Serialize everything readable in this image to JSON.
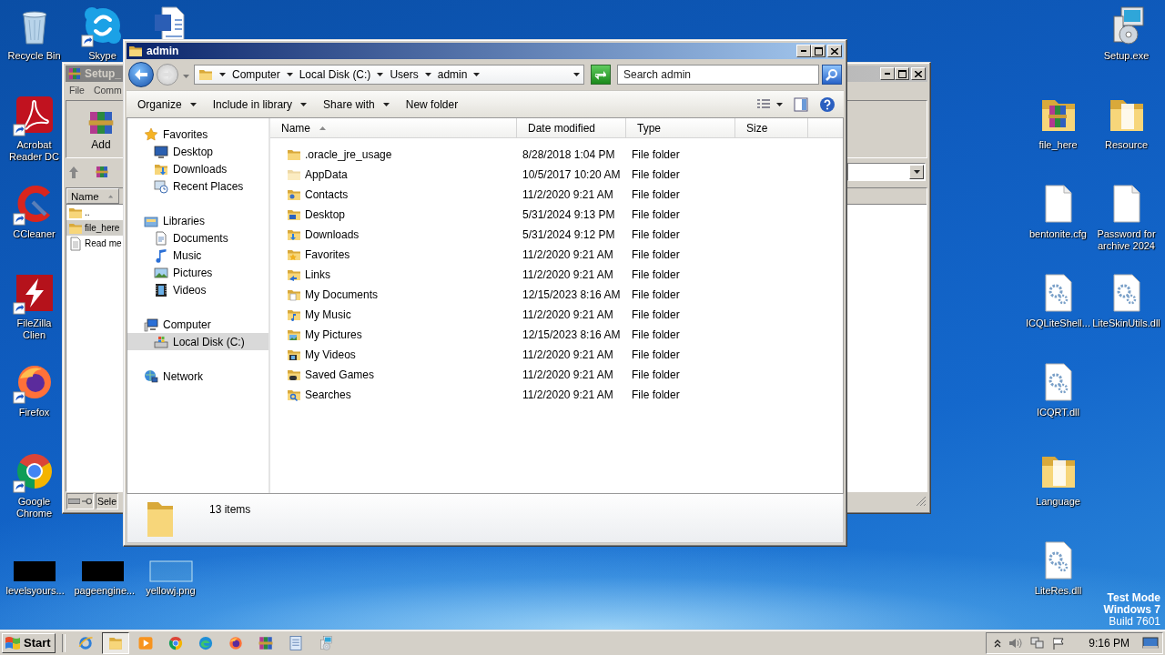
{
  "desktop": {
    "left_icons": [
      {
        "label": "Recycle Bin",
        "kind": "recycle",
        "shortcut": false
      },
      {
        "label": "Skype",
        "kind": "skype",
        "shortcut": true
      },
      {
        "kind": "word",
        "shortcut": false
      },
      {
        "label": "Acrobat Reader DC",
        "kind": "acrobat",
        "shortcut": true
      },
      {
        "label": "CCleaner",
        "kind": "ccleaner",
        "shortcut": true
      },
      {
        "label": "FileZilla Clien",
        "kind": "filezilla",
        "shortcut": true
      },
      {
        "label": "Firefox",
        "kind": "firefox",
        "shortcut": true
      },
      {
        "label": "Google Chrome",
        "kind": "chrome",
        "shortcut": true
      },
      {
        "label": "levelsyours...",
        "kind": "dark-thumb",
        "shortcut": false
      },
      {
        "label": "pageengine...",
        "kind": "dark-thumb",
        "shortcut": false
      },
      {
        "label": "yellowj.png",
        "kind": "blank-thumb",
        "shortcut": false
      }
    ],
    "right_icons": [
      {
        "label": "Setup.exe",
        "kind": "setup"
      },
      {
        "label": "file_here",
        "kind": "archive-folder"
      },
      {
        "label": "Resource",
        "kind": "folder"
      },
      {
        "label": "bentonite.cfg",
        "kind": "file"
      },
      {
        "label": "Password for archive 2024",
        "kind": "file"
      },
      {
        "label": "ICQLiteShell...",
        "kind": "dll"
      },
      {
        "label": "LiteSkinUtils.dll",
        "kind": "dll"
      },
      {
        "label": "ICQRT.dll",
        "kind": "dll"
      },
      {
        "label": "Language",
        "kind": "folder"
      },
      {
        "label": "LiteRes.dll",
        "kind": "dll"
      }
    ],
    "system_notice": [
      "Test Mode",
      "Windows 7",
      "Build 7601"
    ]
  },
  "background_window": {
    "title": "Setup_",
    "menu": [
      "File",
      "Comm"
    ],
    "toolbar": [
      "Add"
    ],
    "list_header": "Name",
    "rows": [
      {
        "name": "..",
        "kind": "folder",
        "selected": false
      },
      {
        "name": "file_here",
        "kind": "folder",
        "selected": true
      },
      {
        "name": "Read me",
        "kind": "text",
        "selected": false
      }
    ],
    "status": "Sele"
  },
  "explorer": {
    "title": "admin",
    "breadcrumb": [
      "Computer",
      "Local Disk (C:)",
      "Users",
      "admin"
    ],
    "search": {
      "placeholder": "Search admin"
    },
    "toolbar": [
      {
        "label": "Organize",
        "menu": true
      },
      {
        "label": "Include in library",
        "menu": true
      },
      {
        "label": "Share with",
        "menu": true
      },
      {
        "label": "New folder",
        "menu": false
      }
    ],
    "navigation": [
      {
        "label": "Favorites",
        "kind": "star",
        "selected": false,
        "children": [
          {
            "label": "Desktop",
            "kind": "desktop",
            "selected": false
          },
          {
            "label": "Downloads",
            "kind": "downloads",
            "selected": false
          },
          {
            "label": "Recent Places",
            "kind": "recent",
            "selected": false
          }
        ]
      },
      {
        "label": "Libraries",
        "kind": "library",
        "selected": false,
        "children": [
          {
            "label": "Documents",
            "kind": "documents",
            "selected": false
          },
          {
            "label": "Music",
            "kind": "music",
            "selected": false
          },
          {
            "label": "Pictures",
            "kind": "pictures",
            "selected": false
          },
          {
            "label": "Videos",
            "kind": "videos",
            "selected": false
          }
        ]
      },
      {
        "label": "Computer",
        "kind": "computer",
        "selected": false,
        "children": [
          {
            "label": "Local Disk (C:)",
            "kind": "disk",
            "selected": true
          }
        ]
      },
      {
        "label": "Network",
        "kind": "network",
        "selected": false
      }
    ],
    "columns": [
      {
        "label": "Name",
        "sorted": true
      },
      {
        "label": "Date modified",
        "sorted": false
      },
      {
        "label": "Type",
        "sorted": false
      },
      {
        "label": "Size",
        "sorted": false
      }
    ],
    "rows": [
      {
        "name": ".oracle_jre_usage",
        "date": "8/28/2018 1:04 PM",
        "type": "File folder",
        "kind": "folder"
      },
      {
        "name": "AppData",
        "date": "10/5/2017 10:20 AM",
        "type": "File folder",
        "kind": "hidden"
      },
      {
        "name": "Contacts",
        "date": "11/2/2020 9:21 AM",
        "type": "File folder",
        "kind": "contacts"
      },
      {
        "name": "Desktop",
        "date": "5/31/2024 9:13 PM",
        "type": "File folder",
        "kind": "desktop"
      },
      {
        "name": "Downloads",
        "date": "5/31/2024 9:12 PM",
        "type": "File folder",
        "kind": "downloads"
      },
      {
        "name": "Favorites",
        "date": "11/2/2020 9:21 AM",
        "type": "File folder",
        "kind": "favorites"
      },
      {
        "name": "Links",
        "date": "11/2/2020 9:21 AM",
        "type": "File folder",
        "kind": "links"
      },
      {
        "name": "My Documents",
        "date": "12/15/2023 8:16 AM",
        "type": "File folder",
        "kind": "documents"
      },
      {
        "name": "My Music",
        "date": "11/2/2020 9:21 AM",
        "type": "File folder",
        "kind": "music"
      },
      {
        "name": "My Pictures",
        "date": "12/15/2023 8:16 AM",
        "type": "File folder",
        "kind": "pictures"
      },
      {
        "name": "My Videos",
        "date": "11/2/2020 9:21 AM",
        "type": "File folder",
        "kind": "videos"
      },
      {
        "name": "Saved Games",
        "date": "11/2/2020 9:21 AM",
        "type": "File folder",
        "kind": "games"
      },
      {
        "name": "Searches",
        "date": "11/2/2020 9:21 AM",
        "type": "File folder",
        "kind": "searches"
      }
    ],
    "status": "13 items"
  },
  "taskbar": {
    "start": "Start",
    "apps": [
      {
        "kind": "ie",
        "active": false
      },
      {
        "kind": "explorer",
        "active": true
      },
      {
        "kind": "media",
        "active": false
      },
      {
        "kind": "chrome",
        "active": false
      },
      {
        "kind": "edge",
        "active": false
      },
      {
        "kind": "firefox",
        "active": false
      },
      {
        "kind": "winrar",
        "active": false
      },
      {
        "kind": "notepad",
        "active": false
      },
      {
        "kind": "setup",
        "active": false
      }
    ],
    "clock": "9:16 PM"
  }
}
